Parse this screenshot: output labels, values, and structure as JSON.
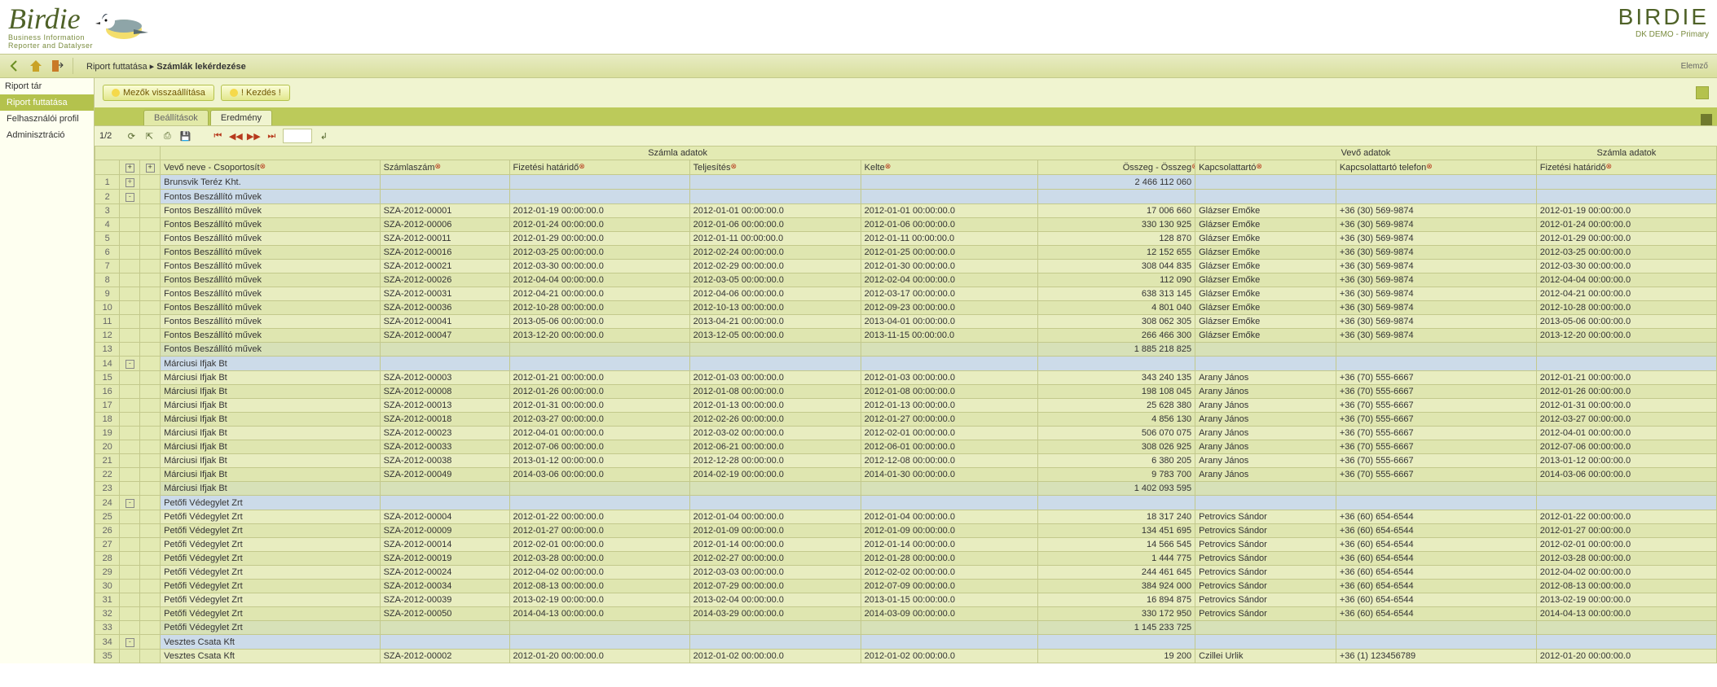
{
  "brand": {
    "logoMain": "Birdie",
    "logoSub1": "Business Information",
    "logoSub2": "Reporter and Datalyser",
    "right": "BIRDIE",
    "rightSub": "DK DEMO - Primary"
  },
  "breadcrumb": {
    "part1": "Riport futtatása",
    "sep": "▸",
    "part2": "Számlák lekérdezése"
  },
  "userLabel": "Elemző",
  "sidebar": {
    "title": "Riport tár",
    "items": [
      "Riport futtatása",
      "Felhasználói profil",
      "Adminisztráció"
    ],
    "active": 0
  },
  "buttons": {
    "reset": "Mezők visszaállítása",
    "start": "! Kezdés !"
  },
  "tabs": {
    "settings": "Beállítások",
    "result": "Eredmény"
  },
  "pager": {
    "text": "1/2"
  },
  "groupHeaders": {
    "g1": "Számla adatok",
    "g2": "Vevő adatok",
    "g3": "Számla adatok"
  },
  "columns": {
    "name": "Vevő neve - Csoportosít",
    "inv": "Számlaszám",
    "due": "Fizetési határidő",
    "telj": "Teljesítés",
    "kelt": "Kelte",
    "sum": "Összeg - Összeg",
    "cont": "Kapcsolattartó",
    "tel": "Kapcsolattartó telefon",
    "due2": "Fizetési határidő"
  },
  "rows": [
    {
      "n": 1,
      "type": "group",
      "exp": "+",
      "name": "Brunsvik Teréz Kht.",
      "sum": "2 466 112 060"
    },
    {
      "n": 2,
      "type": "group",
      "exp": "-",
      "name": "Fontos Beszállító művek",
      "sum": ""
    },
    {
      "n": 3,
      "type": "data",
      "name": "Fontos Beszállító művek",
      "inv": "SZA-2012-00001",
      "due": "2012-01-19 00:00:00.0",
      "telj": "2012-01-01 00:00:00.0",
      "kelt": "2012-01-01 00:00:00.0",
      "sum": "17 006 660",
      "cont": "Glázser Emőke",
      "tel": "+36 (30) 569-9874",
      "due2": "2012-01-19 00:00:00.0"
    },
    {
      "n": 4,
      "type": "data",
      "name": "Fontos Beszállító művek",
      "inv": "SZA-2012-00006",
      "due": "2012-01-24 00:00:00.0",
      "telj": "2012-01-06 00:00:00.0",
      "kelt": "2012-01-06 00:00:00.0",
      "sum": "330 130 925",
      "cont": "Glázser Emőke",
      "tel": "+36 (30) 569-9874",
      "due2": "2012-01-24 00:00:00.0"
    },
    {
      "n": 5,
      "type": "data",
      "name": "Fontos Beszállító művek",
      "inv": "SZA-2012-00011",
      "due": "2012-01-29 00:00:00.0",
      "telj": "2012-01-11 00:00:00.0",
      "kelt": "2012-01-11 00:00:00.0",
      "sum": "128 870",
      "cont": "Glázser Emőke",
      "tel": "+36 (30) 569-9874",
      "due2": "2012-01-29 00:00:00.0"
    },
    {
      "n": 6,
      "type": "data",
      "name": "Fontos Beszállító művek",
      "inv": "SZA-2012-00016",
      "due": "2012-03-25 00:00:00.0",
      "telj": "2012-02-24 00:00:00.0",
      "kelt": "2012-01-25 00:00:00.0",
      "sum": "12 152 655",
      "cont": "Glázser Emőke",
      "tel": "+36 (30) 569-9874",
      "due2": "2012-03-25 00:00:00.0"
    },
    {
      "n": 7,
      "type": "data",
      "name": "Fontos Beszállító művek",
      "inv": "SZA-2012-00021",
      "due": "2012-03-30 00:00:00.0",
      "telj": "2012-02-29 00:00:00.0",
      "kelt": "2012-01-30 00:00:00.0",
      "sum": "308 044 835",
      "cont": "Glázser Emőke",
      "tel": "+36 (30) 569-9874",
      "due2": "2012-03-30 00:00:00.0"
    },
    {
      "n": 8,
      "type": "data",
      "name": "Fontos Beszállító művek",
      "inv": "SZA-2012-00026",
      "due": "2012-04-04 00:00:00.0",
      "telj": "2012-03-05 00:00:00.0",
      "kelt": "2012-02-04 00:00:00.0",
      "sum": "112 090",
      "cont": "Glázser Emőke",
      "tel": "+36 (30) 569-9874",
      "due2": "2012-04-04 00:00:00.0"
    },
    {
      "n": 9,
      "type": "data",
      "name": "Fontos Beszállító művek",
      "inv": "SZA-2012-00031",
      "due": "2012-04-21 00:00:00.0",
      "telj": "2012-04-06 00:00:00.0",
      "kelt": "2012-03-17 00:00:00.0",
      "sum": "638 313 145",
      "cont": "Glázser Emőke",
      "tel": "+36 (30) 569-9874",
      "due2": "2012-04-21 00:00:00.0"
    },
    {
      "n": 10,
      "type": "data",
      "name": "Fontos Beszállító művek",
      "inv": "SZA-2012-00036",
      "due": "2012-10-28 00:00:00.0",
      "telj": "2012-10-13 00:00:00.0",
      "kelt": "2012-09-23 00:00:00.0",
      "sum": "4 801 040",
      "cont": "Glázser Emőke",
      "tel": "+36 (30) 569-9874",
      "due2": "2012-10-28 00:00:00.0"
    },
    {
      "n": 11,
      "type": "data",
      "name": "Fontos Beszállító művek",
      "inv": "SZA-2012-00041",
      "due": "2013-05-06 00:00:00.0",
      "telj": "2013-04-21 00:00:00.0",
      "kelt": "2013-04-01 00:00:00.0",
      "sum": "308 062 305",
      "cont": "Glázser Emőke",
      "tel": "+36 (30) 569-9874",
      "due2": "2013-05-06 00:00:00.0"
    },
    {
      "n": 12,
      "type": "data",
      "name": "Fontos Beszállító művek",
      "inv": "SZA-2012-00047",
      "due": "2013-12-20 00:00:00.0",
      "telj": "2013-12-05 00:00:00.0",
      "kelt": "2013-11-15 00:00:00.0",
      "sum": "266 466 300",
      "cont": "Glázser Emőke",
      "tel": "+36 (30) 569-9874",
      "due2": "2013-12-20 00:00:00.0"
    },
    {
      "n": 13,
      "type": "subtotal",
      "name": "Fontos Beszállító művek",
      "sum": "1 885 218 825"
    },
    {
      "n": 14,
      "type": "group",
      "exp": "-",
      "name": "Márciusi Ifjak Bt",
      "sum": ""
    },
    {
      "n": 15,
      "type": "data",
      "name": "Márciusi Ifjak Bt",
      "inv": "SZA-2012-00003",
      "due": "2012-01-21 00:00:00.0",
      "telj": "2012-01-03 00:00:00.0",
      "kelt": "2012-01-03 00:00:00.0",
      "sum": "343 240 135",
      "cont": "Arany János",
      "tel": "+36 (70) 555-6667",
      "due2": "2012-01-21 00:00:00.0"
    },
    {
      "n": 16,
      "type": "data",
      "name": "Márciusi Ifjak Bt",
      "inv": "SZA-2012-00008",
      "due": "2012-01-26 00:00:00.0",
      "telj": "2012-01-08 00:00:00.0",
      "kelt": "2012-01-08 00:00:00.0",
      "sum": "198 108 045",
      "cont": "Arany János",
      "tel": "+36 (70) 555-6667",
      "due2": "2012-01-26 00:00:00.0"
    },
    {
      "n": 17,
      "type": "data",
      "name": "Márciusi Ifjak Bt",
      "inv": "SZA-2012-00013",
      "due": "2012-01-31 00:00:00.0",
      "telj": "2012-01-13 00:00:00.0",
      "kelt": "2012-01-13 00:00:00.0",
      "sum": "25 628 380",
      "cont": "Arany János",
      "tel": "+36 (70) 555-6667",
      "due2": "2012-01-31 00:00:00.0"
    },
    {
      "n": 18,
      "type": "data",
      "name": "Márciusi Ifjak Bt",
      "inv": "SZA-2012-00018",
      "due": "2012-03-27 00:00:00.0",
      "telj": "2012-02-26 00:00:00.0",
      "kelt": "2012-01-27 00:00:00.0",
      "sum": "4 856 130",
      "cont": "Arany János",
      "tel": "+36 (70) 555-6667",
      "due2": "2012-03-27 00:00:00.0"
    },
    {
      "n": 19,
      "type": "data",
      "name": "Márciusi Ifjak Bt",
      "inv": "SZA-2012-00023",
      "due": "2012-04-01 00:00:00.0",
      "telj": "2012-03-02 00:00:00.0",
      "kelt": "2012-02-01 00:00:00.0",
      "sum": "506 070 075",
      "cont": "Arany János",
      "tel": "+36 (70) 555-6667",
      "due2": "2012-04-01 00:00:00.0"
    },
    {
      "n": 20,
      "type": "data",
      "name": "Márciusi Ifjak Bt",
      "inv": "SZA-2012-00033",
      "due": "2012-07-06 00:00:00.0",
      "telj": "2012-06-21 00:00:00.0",
      "kelt": "2012-06-01 00:00:00.0",
      "sum": "308 026 925",
      "cont": "Arany János",
      "tel": "+36 (70) 555-6667",
      "due2": "2012-07-06 00:00:00.0"
    },
    {
      "n": 21,
      "type": "data",
      "name": "Márciusi Ifjak Bt",
      "inv": "SZA-2012-00038",
      "due": "2013-01-12 00:00:00.0",
      "telj": "2012-12-28 00:00:00.0",
      "kelt": "2012-12-08 00:00:00.0",
      "sum": "6 380 205",
      "cont": "Arany János",
      "tel": "+36 (70) 555-6667",
      "due2": "2013-01-12 00:00:00.0"
    },
    {
      "n": 22,
      "type": "data",
      "name": "Márciusi Ifjak Bt",
      "inv": "SZA-2012-00049",
      "due": "2014-03-06 00:00:00.0",
      "telj": "2014-02-19 00:00:00.0",
      "kelt": "2014-01-30 00:00:00.0",
      "sum": "9 783 700",
      "cont": "Arany János",
      "tel": "+36 (70) 555-6667",
      "due2": "2014-03-06 00:00:00.0"
    },
    {
      "n": 23,
      "type": "subtotal",
      "name": "Márciusi Ifjak Bt",
      "sum": "1 402 093 595"
    },
    {
      "n": 24,
      "type": "group",
      "exp": "-",
      "name": "Petőfi Védegylet Zrt",
      "sum": ""
    },
    {
      "n": 25,
      "type": "data",
      "name": "Petőfi Védegylet Zrt",
      "inv": "SZA-2012-00004",
      "due": "2012-01-22 00:00:00.0",
      "telj": "2012-01-04 00:00:00.0",
      "kelt": "2012-01-04 00:00:00.0",
      "sum": "18 317 240",
      "cont": "Petrovics Sándor",
      "tel": "+36 (60) 654-6544",
      "due2": "2012-01-22 00:00:00.0"
    },
    {
      "n": 26,
      "type": "data",
      "name": "Petőfi Védegylet Zrt",
      "inv": "SZA-2012-00009",
      "due": "2012-01-27 00:00:00.0",
      "telj": "2012-01-09 00:00:00.0",
      "kelt": "2012-01-09 00:00:00.0",
      "sum": "134 451 695",
      "cont": "Petrovics Sándor",
      "tel": "+36 (60) 654-6544",
      "due2": "2012-01-27 00:00:00.0"
    },
    {
      "n": 27,
      "type": "data",
      "name": "Petőfi Védegylet Zrt",
      "inv": "SZA-2012-00014",
      "due": "2012-02-01 00:00:00.0",
      "telj": "2012-01-14 00:00:00.0",
      "kelt": "2012-01-14 00:00:00.0",
      "sum": "14 566 545",
      "cont": "Petrovics Sándor",
      "tel": "+36 (60) 654-6544",
      "due2": "2012-02-01 00:00:00.0"
    },
    {
      "n": 28,
      "type": "data",
      "name": "Petőfi Védegylet Zrt",
      "inv": "SZA-2012-00019",
      "due": "2012-03-28 00:00:00.0",
      "telj": "2012-02-27 00:00:00.0",
      "kelt": "2012-01-28 00:00:00.0",
      "sum": "1 444 775",
      "cont": "Petrovics Sándor",
      "tel": "+36 (60) 654-6544",
      "due2": "2012-03-28 00:00:00.0"
    },
    {
      "n": 29,
      "type": "data",
      "name": "Petőfi Védegylet Zrt",
      "inv": "SZA-2012-00024",
      "due": "2012-04-02 00:00:00.0",
      "telj": "2012-03-03 00:00:00.0",
      "kelt": "2012-02-02 00:00:00.0",
      "sum": "244 461 645",
      "cont": "Petrovics Sándor",
      "tel": "+36 (60) 654-6544",
      "due2": "2012-04-02 00:00:00.0"
    },
    {
      "n": 30,
      "type": "data",
      "name": "Petőfi Védegylet Zrt",
      "inv": "SZA-2012-00034",
      "due": "2012-08-13 00:00:00.0",
      "telj": "2012-07-29 00:00:00.0",
      "kelt": "2012-07-09 00:00:00.0",
      "sum": "384 924 000",
      "cont": "Petrovics Sándor",
      "tel": "+36 (60) 654-6544",
      "due2": "2012-08-13 00:00:00.0"
    },
    {
      "n": 31,
      "type": "data",
      "name": "Petőfi Védegylet Zrt",
      "inv": "SZA-2012-00039",
      "due": "2013-02-19 00:00:00.0",
      "telj": "2013-02-04 00:00:00.0",
      "kelt": "2013-01-15 00:00:00.0",
      "sum": "16 894 875",
      "cont": "Petrovics Sándor",
      "tel": "+36 (60) 654-6544",
      "due2": "2013-02-19 00:00:00.0"
    },
    {
      "n": 32,
      "type": "data",
      "name": "Petőfi Védegylet Zrt",
      "inv": "SZA-2012-00050",
      "due": "2014-04-13 00:00:00.0",
      "telj": "2014-03-29 00:00:00.0",
      "kelt": "2014-03-09 00:00:00.0",
      "sum": "330 172 950",
      "cont": "Petrovics Sándor",
      "tel": "+36 (60) 654-6544",
      "due2": "2014-04-13 00:00:00.0"
    },
    {
      "n": 33,
      "type": "subtotal",
      "name": "Petőfi Védegylet Zrt",
      "sum": "1 145 233 725"
    },
    {
      "n": 34,
      "type": "group",
      "exp": "-",
      "name": "Vesztes Csata Kft",
      "sum": ""
    },
    {
      "n": 35,
      "type": "data",
      "name": "Vesztes Csata Kft",
      "inv": "SZA-2012-00002",
      "due": "2012-01-20 00:00:00.0",
      "telj": "2012-01-02 00:00:00.0",
      "kelt": "2012-01-02 00:00:00.0",
      "sum": "19 200",
      "cont": "Czillei Urlik",
      "tel": "+36 (1) 123456789",
      "due2": "2012-01-20 00:00:00.0"
    }
  ]
}
